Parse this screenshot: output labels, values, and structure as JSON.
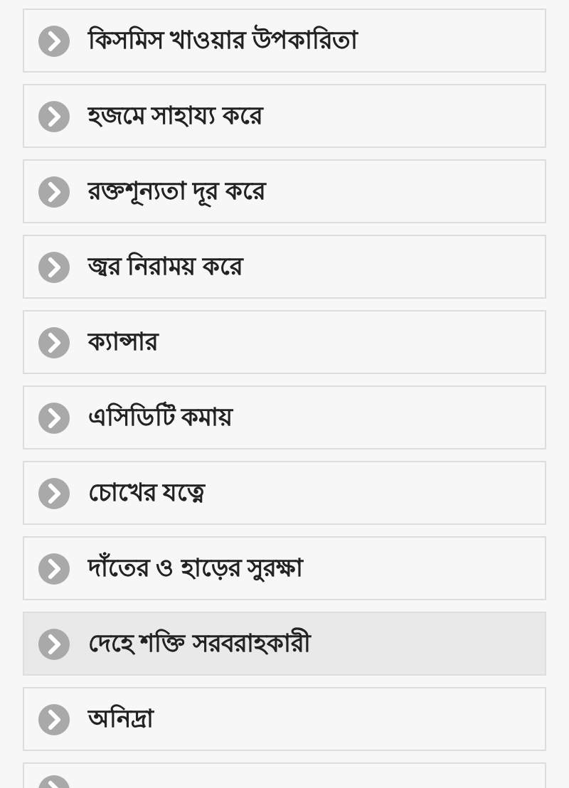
{
  "items": [
    {
      "kind": "link",
      "label": "কিসমিস খাওয়ার উপকারিতা",
      "selected": false
    },
    {
      "kind": "link",
      "label": "হজমে সাহায্য করে",
      "selected": false
    },
    {
      "kind": "link",
      "label": "রক্তশূন্যতা দূর করে",
      "selected": false
    },
    {
      "kind": "link",
      "label": "জ্বর নিরাময় করে",
      "selected": false
    },
    {
      "kind": "link",
      "label": "ক্যান্সার",
      "selected": false
    },
    {
      "kind": "link",
      "label": "এসিডিটি কমায়",
      "selected": false
    },
    {
      "kind": "link",
      "label": "চোখের যত্নে",
      "selected": false
    },
    {
      "kind": "link",
      "label": "দাঁতের ও হাড়ের সুরক্ষা",
      "selected": false
    },
    {
      "kind": "link",
      "label": "দেহে শক্তি সরবরাহকারী",
      "selected": true
    },
    {
      "kind": "link",
      "label": "অনিদ্রা",
      "selected": false
    },
    {
      "kind": "cut",
      "selected": false
    }
  ]
}
